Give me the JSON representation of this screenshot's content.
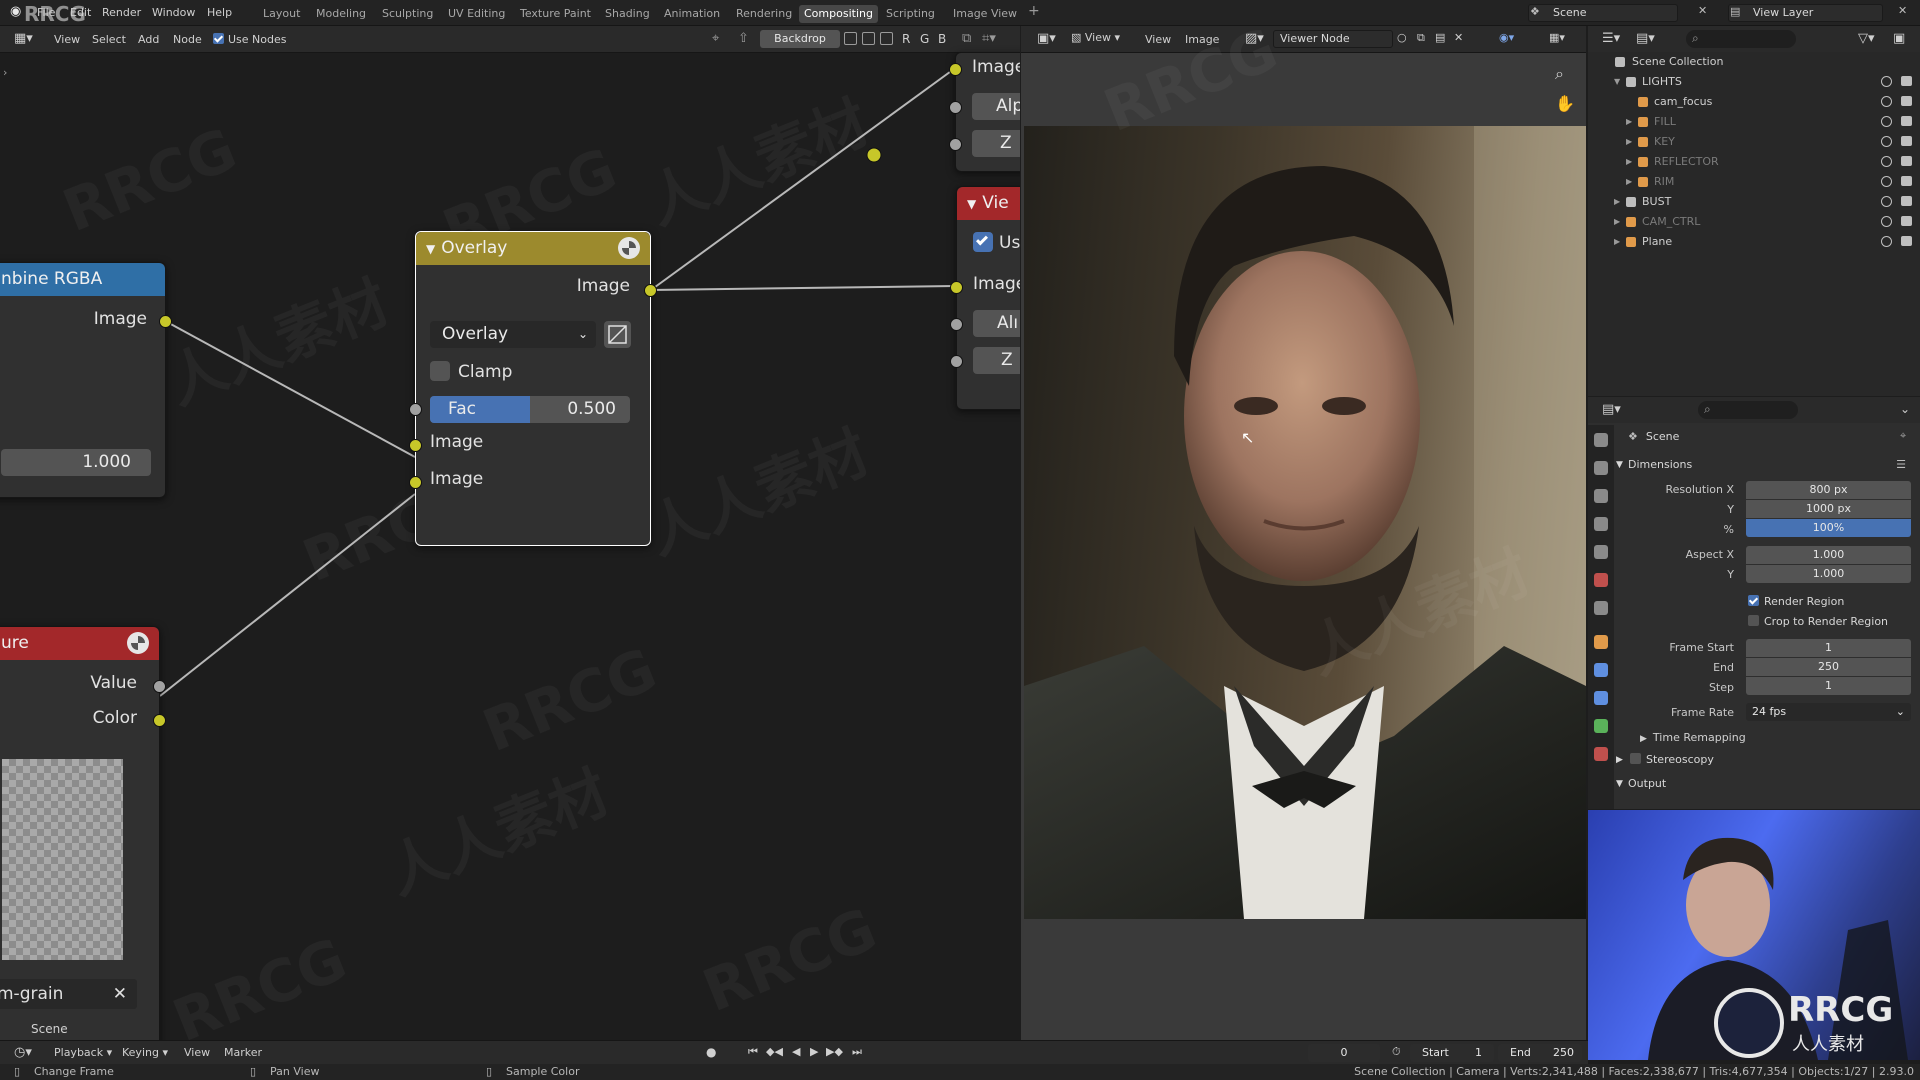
{
  "topbar": {
    "menus": [
      "File",
      "Edit",
      "Render",
      "Window",
      "Help"
    ],
    "workspaces": [
      "Layout",
      "Modeling",
      "Sculpting",
      "UV Editing",
      "Texture Paint",
      "Shading",
      "Animation",
      "Rendering",
      "Compositing",
      "Scripting",
      "Image View"
    ],
    "active_workspace": "Compositing",
    "scene": "Scene",
    "view_layer": "View Layer",
    "logo_text": "RRCG"
  },
  "node_editor": {
    "menus": [
      "View",
      "Select",
      "Add",
      "Node"
    ],
    "use_nodes_label": "Use Nodes",
    "backdrop_label": "Backdrop",
    "channel_letters": [
      "R",
      "G",
      "B"
    ]
  },
  "nodes": {
    "overlay": {
      "title": "Overlay",
      "output_label": "Image",
      "blend_mode": "Overlay",
      "clamp_label": "Clamp",
      "clamp_checked": false,
      "fac_label": "Fac",
      "fac_value": "0.500",
      "fac_fraction": 0.5,
      "input_image_1": "Image",
      "input_image_2": "Image"
    },
    "combine": {
      "title": "nbine RGBA",
      "output_label": "Image",
      "value": "1.000"
    },
    "texture": {
      "title": "ure",
      "output_value": "Value",
      "output_color": "Color",
      "texture_name": "m-grain",
      "scene_label": "Scene"
    },
    "viewer": {
      "title": "Vie",
      "use_alpha_label": "Us",
      "input_image": "Image",
      "input_alpha": "Alı",
      "input_z": "Z"
    },
    "composite": {
      "input_image": "Image",
      "input_alpha": "Alp",
      "input_z": "Z"
    }
  },
  "viewer_editor": {
    "menus": [
      "View",
      "View",
      "Image"
    ],
    "viewer_node_label": "Viewer Node"
  },
  "outliner": {
    "title": "Scene Collection",
    "items": [
      {
        "label": "LIGHTS",
        "color": "#d0d0d0",
        "icon_color": "#bdbdbd"
      },
      {
        "label": "cam_focus",
        "color": "#d0d0d0",
        "icon_color": "#e09a4a"
      },
      {
        "label": "FILL",
        "color": "#7a7a7a",
        "icon_color": "#e09a4a"
      },
      {
        "label": "KEY",
        "color": "#7a7a7a",
        "icon_color": "#e09a4a"
      },
      {
        "label": "REFLECTOR",
        "color": "#7a7a7a",
        "icon_color": "#e09a4a"
      },
      {
        "label": "RIM",
        "color": "#7a7a7a",
        "icon_color": "#e09a4a"
      },
      {
        "label": "BUST",
        "color": "#d0d0d0",
        "icon_color": "#bdbdbd"
      },
      {
        "label": "CAM_CTRL",
        "color": "#7a7a7a",
        "icon_color": "#e09a4a"
      },
      {
        "label": "Plane",
        "color": "#d0d0d0",
        "icon_color": "#e09a4a"
      }
    ]
  },
  "properties": {
    "context": "Scene",
    "dimensions_label": "Dimensions",
    "resolution_x_label": "Resolution X",
    "resolution_x": "800 px",
    "resolution_y_label": "Y",
    "resolution_y": "1000 px",
    "resolution_pct_label": "%",
    "resolution_pct": "100%",
    "aspect_x_label": "Aspect X",
    "aspect_x": "1.000",
    "aspect_y_label": "Y",
    "aspect_y": "1.000",
    "render_region_label": "Render Region",
    "render_region": true,
    "crop_label": "Crop to Render Region",
    "crop": false,
    "frame_start_label": "Frame Start",
    "frame_start": "1",
    "frame_end_label": "End",
    "frame_end": "250",
    "frame_step_label": "Step",
    "frame_step": "1",
    "frame_rate_label": "Frame Rate",
    "frame_rate": "24 fps",
    "time_remapping_label": "Time Remapping",
    "stereoscopy_label": "Stereoscopy",
    "output_label": "Output"
  },
  "timeline": {
    "menus": [
      "Playback",
      "Keying",
      "View",
      "Marker"
    ],
    "current_frame": "0",
    "start_label": "Start",
    "start": "1",
    "end_label": "End",
    "end": "250"
  },
  "statusbar": {
    "change_frame": "Change Frame",
    "pan_view": "Pan View",
    "sample_color": "Sample Color",
    "stats": "Scene Collection | Camera | Verts:2,341,488 | Faces:2,338,677 | Tris:4,677,354 | Objects:1/27 | 2.93.0"
  },
  "watermark": {
    "brand": "RRCG",
    "cn": "人人素材",
    "logo_cn": "人人素材"
  },
  "colors": {
    "overlay_header": "#9c8a2d",
    "combine_header": "#2f6fa6",
    "texture_header": "#a3282a",
    "viewer_header": "#a3282a",
    "image_socket": "#c7c729",
    "value_socket": "#a1a1a1",
    "accent": "#4772b3"
  }
}
